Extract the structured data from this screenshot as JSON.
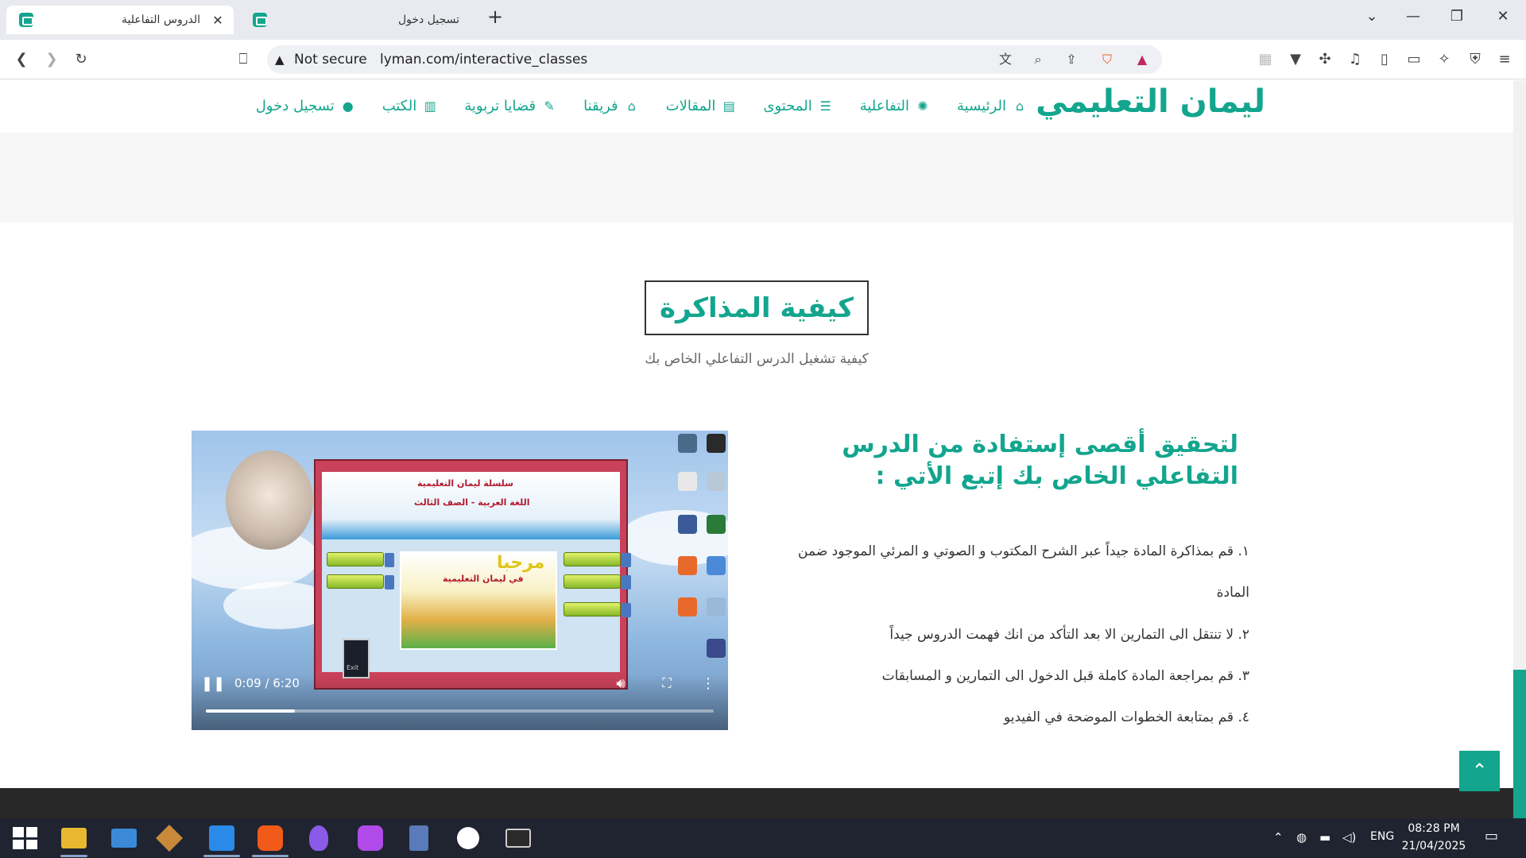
{
  "browser": {
    "tabs": [
      {
        "title": "الدروس التفاعلية",
        "active": true
      },
      {
        "title": "تسجيل دخول",
        "active": false
      }
    ],
    "new_tab": "+",
    "security_label": "Not secure",
    "url": "lyman.com/interactive_classes"
  },
  "site": {
    "logo": "ليمان التعليمي",
    "nav": [
      {
        "label": "الرئيسية",
        "icon": "home-icon"
      },
      {
        "label": "التفاعلية",
        "icon": "gear-icon"
      },
      {
        "label": "المحتوى",
        "icon": "list-icon"
      },
      {
        "label": "المقالات",
        "icon": "newspaper-icon"
      },
      {
        "label": "فريقنا",
        "icon": "team-icon"
      },
      {
        "label": "قضايا تربوية",
        "icon": "pen-icon"
      },
      {
        "label": "الكتب",
        "icon": "book-icon"
      },
      {
        "label": "تسجيل دخول",
        "icon": "user-circle-icon"
      }
    ]
  },
  "section": {
    "title": "كيفية المذاكرة",
    "subtitle": "كيفية تشغيل الدرس التفاعلي الخاص بك"
  },
  "tips": {
    "heading": "لتحقيق أقصى إستفادة من الدرس التفاعلي الخاص بك إتبع الأتي :",
    "items": [
      "١. قم بمذاكرة المادة جيداً عبر الشرح المكتوب و الصوتي و المرئي الموجود ضمن المادة",
      "٢. لا تنتقل الى التمارين الا بعد التأكد من انك فهمت الدروس جيداً",
      "٣. قم بمراجعة المادة كاملة قبل الدخول الى التمارين و المسابقات",
      "٤. قم بمتابعة الخطوات الموضحة في الفيديو"
    ]
  },
  "video": {
    "time": "0:09 / 6:20",
    "progress": 0.176,
    "app_title": "سلسلة ليمان التعليمية",
    "app_subtitle": "اللغة العربية - الصف الثالث",
    "welcome": "مرحبا",
    "welcome_sub": "في ليمان التعليمية",
    "exit_label": "Exit"
  },
  "taskbar": {
    "lang": "ENG",
    "time": "08:28 PM",
    "date": "21/04/2025"
  },
  "colors": {
    "brand": "#13a58e",
    "footer": "#282828",
    "taskbar": "#1f2430"
  }
}
